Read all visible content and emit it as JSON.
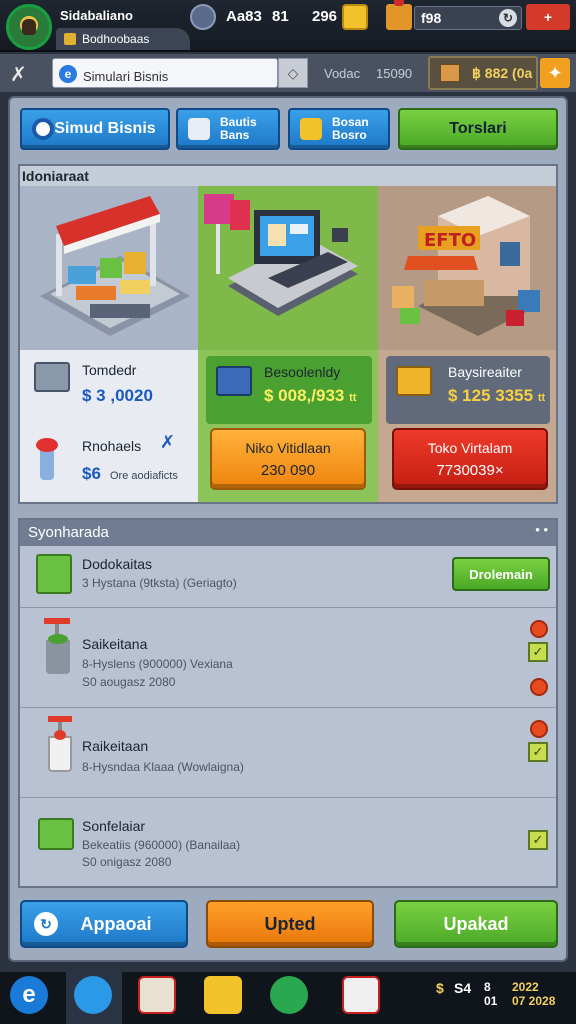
{
  "topbar": {
    "title": "Sidabaliano",
    "subtitle": "Bodhoobaas",
    "stat1": "Aa83",
    "stat2": "81",
    "stat3": "296",
    "money": "f98",
    "close": "+"
  },
  "toolbar": {
    "search_value": "Simulari Bisnis",
    "label1": "Vodac",
    "label2": "15090",
    "crate_value": "฿ 882 (0a"
  },
  "tabs": {
    "tab1": "Simud Bisnis",
    "tab2_line1": "Bautis",
    "tab2_line2": "Bans",
    "tab3_line1": "Bosan",
    "tab3_line2": "Bosro",
    "tab4": "Torslari"
  },
  "shop": {
    "header": "Idoniaraat",
    "store_sign": "EFTO",
    "card1": {
      "name": "Tomdedr",
      "price": "$ 3 ,0020",
      "name2": "Rnohaels",
      "price2": "$6",
      "note2": "Ore aodiaficts"
    },
    "card2": {
      "name": "Besoolenldy",
      "price": "$ 008,/933",
      "price_suffix": "tt",
      "button_title": "Niko Vitidlaan",
      "button_value": "230 090"
    },
    "card3": {
      "name": "Baysireaiter",
      "price": "$ 125 3355",
      "price_suffix": "tt",
      "button_title": "Toko Virtalam",
      "button_value": "7730039×"
    }
  },
  "list": {
    "header": "Syonharada",
    "rows": [
      {
        "title": "Dodokaitas",
        "meta": "3 Hystana (9tksta) (Geriagto)",
        "meta2": "",
        "button": "Drolemain"
      },
      {
        "title": "Saikeitana",
        "meta": "8-Hyslens (900000) Vexiana",
        "meta2": "S0 aougasz 2080"
      },
      {
        "title": "Raikeitaan",
        "meta": "8-Hysndaa Klaaa (Wowlaigna)",
        "meta2": ""
      },
      {
        "title": "Sonfelaiar",
        "meta": "Bekeatiis (960000) (Banailaa)",
        "meta2": "S0 onigasz 2080"
      }
    ]
  },
  "bottom": {
    "btn1": "Appaoai",
    "btn2": "Upted",
    "btn3": "Upakad"
  },
  "tray": {
    "value1": "S4",
    "value2_top": "2022",
    "value2_bottom": "07 2028",
    "time_top": "8",
    "time_bottom": "01"
  }
}
